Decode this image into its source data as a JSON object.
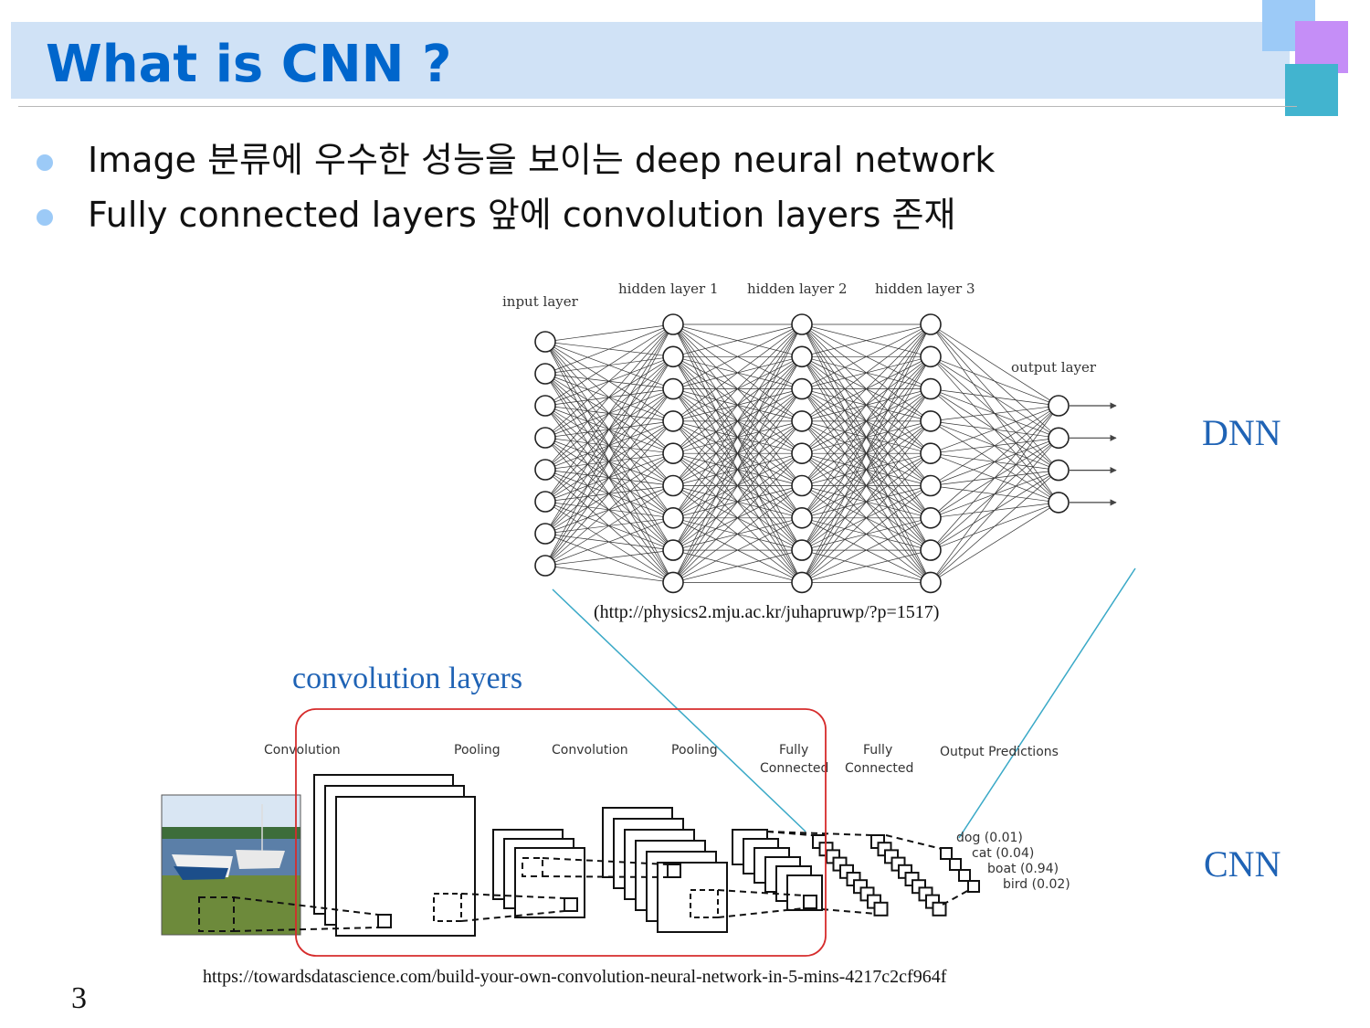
{
  "title": "What is CNN ?",
  "bullets": [
    "Image 분류에 우수한 성능을 보이는 deep neural network",
    "Fully connected layers 앞에 convolution layers 존재"
  ],
  "dnn": {
    "label": "DNN",
    "layer_labels": [
      "input layer",
      "hidden layer 1",
      "hidden layer 2",
      "hidden layer 3",
      "output layer"
    ],
    "source": "(http://physics2.mju.ac.kr/juhapruwp/?p=1517)"
  },
  "cnn": {
    "label": "CNN",
    "conv_group_label": "convolution layers",
    "stage_labels": {
      "conv1": "Convolution",
      "pool1": "Pooling",
      "conv2": "Convolution",
      "pool2": "Pooling",
      "fc1_line1": "Fully",
      "fc1_line2": "Connected",
      "fc2_line1": "Fully",
      "fc2_line2": "Connected",
      "output": "Output Predictions"
    },
    "predictions": [
      "dog (0.01)",
      "cat (0.04)",
      "boat (0.94)",
      "bird (0.02)"
    ],
    "source": "https://towardsdatascience.com/build-your-own-convolution-neural-network-in-5-mins-4217c2cf964f"
  },
  "page_number": "3",
  "colors": {
    "title": "#0066cc",
    "title_bar": "#d0e2f6",
    "bullet_dot": "#9ccaf7",
    "label_blue": "#1f63b5",
    "conv_box": "#d62c2c",
    "connector": "#3aa9c7"
  }
}
